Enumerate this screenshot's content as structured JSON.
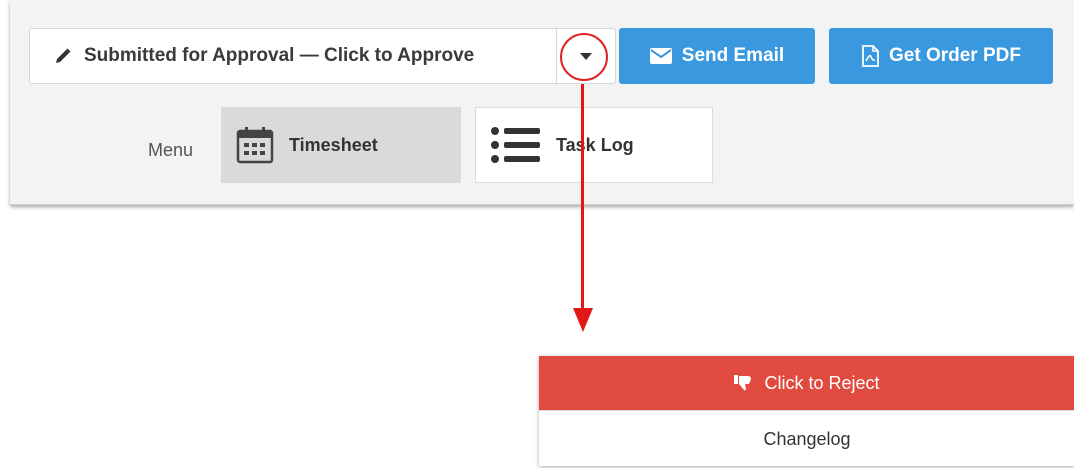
{
  "status_button": {
    "label": "Submitted for Approval — Click to Approve",
    "icon": "pencil-icon"
  },
  "dropdown_toggle": {
    "icon": "caret-down-icon"
  },
  "send_email": {
    "label": "Send Email",
    "icon": "envelope-icon"
  },
  "order_pdf": {
    "label": "Get Order PDF",
    "icon": "pdf-file-icon"
  },
  "menu": {
    "label": "Menu",
    "tabs": [
      {
        "label": "Timesheet",
        "icon": "calendar-icon",
        "active": true
      },
      {
        "label": "Task Log",
        "icon": "list-icon",
        "active": false
      }
    ]
  },
  "dropdown_menu": {
    "items": [
      {
        "label": "Click to Reject",
        "icon": "thumbs-down-icon"
      },
      {
        "label": "Changelog"
      }
    ]
  },
  "colors": {
    "primary": "#3a98de",
    "danger": "#e04a3f",
    "annotation": "#e01818"
  }
}
